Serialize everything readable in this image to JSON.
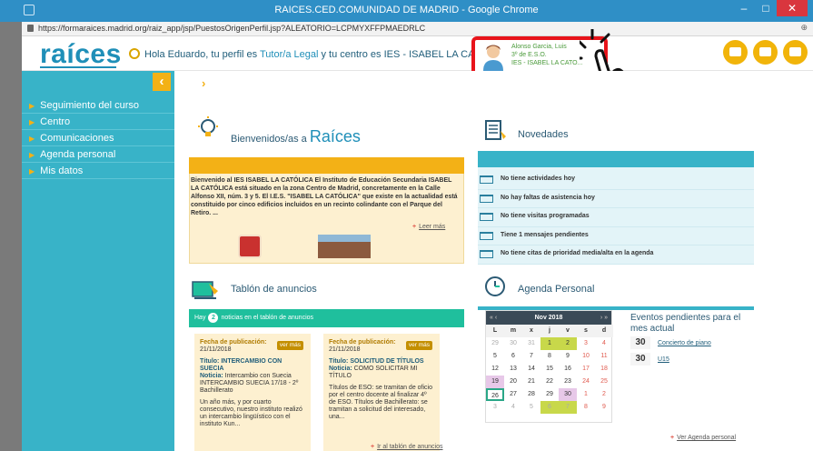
{
  "window": {
    "title": "RAICES.CED.COMUNIDAD DE MADRID - Google Chrome",
    "minimize": "–",
    "maximize": "□",
    "close": "✕"
  },
  "browser": {
    "url": "https://formaraices.madrid.org/raiz_app/jsp/PuestosOrigenPerfil.jsp?ALEATORIO=LCPMYXFFPMAEDRLC",
    "zoom_icon": "⊕"
  },
  "header": {
    "brand": "raíces",
    "greeting_prefix": "Hola Eduardo",
    "greeting_middle": ", tu perfil es ",
    "profile_link": "Tutor/a Legal",
    "greeting_suffix": " y tu centro es IES - ISABEL LA CATOLICA.",
    "close_icon": "✖",
    "profile_name": "Alonso Garcia, Luis",
    "profile_course": "3º de E.S.O.",
    "profile_school": "IES - ISABEL LA CATO...",
    "icons": [
      "mail-icon",
      "documents-icon",
      "settings-icon"
    ]
  },
  "sidebar": {
    "toggle": "‹",
    "items": [
      {
        "label": "Seguimiento del curso"
      },
      {
        "label": "Centro"
      },
      {
        "label": "Comunicaciones"
      },
      {
        "label": "Agenda personal"
      },
      {
        "label": "Mis datos"
      }
    ]
  },
  "main": {
    "breadcrumb_arrow": "›",
    "welcome": {
      "title_prefix": "Bienvenidos/as a",
      "title_brand": "Raíces",
      "text": "Bienvenido al IES ISABEL LA CATÓLICA El Instituto de Educación Secundaria ISABEL LA CATÓLICA está situado en la zona Centro de Madrid, concretamente en la Calle Alfonso XII, núm. 3 y 5. El I.E.S. \"ISABEL LA CATÓLICA\" que existe en la actualidad está constituido por cinco edificios incluidos en un recinto colindante con el Parque del Retiro. ...",
      "more_link": "Leer más"
    },
    "novedades": {
      "title": "Novedades",
      "items": [
        "No tiene actividades hoy",
        "No hay faltas de asistencia hoy",
        "No tiene visitas programadas",
        "Tiene 1 mensajes pendientes",
        "No tiene citas de prioridad media/alta en la agenda"
      ]
    },
    "tablon": {
      "title": "Tablón de anuncios",
      "bar_prefix": "Hay",
      "bar_count": "2",
      "bar_suffix": "noticias en el tablón de anuncios",
      "cards": [
        {
          "date_label": "Fecha de publicación:",
          "date": "21/11/2018",
          "button": "ver más",
          "title_label": "Título: INTERCAMBIO CON SUECIA",
          "notice_label": "Noticia:",
          "notice": "Intercambio con Suecia INTERCAMBIO SUECIA 17/18 - 2º Bachillerato",
          "body": "Un año más, y por cuarto consecutivo, nuestro instituto realizó un intercambio lingüístico con el instituto Kun..."
        },
        {
          "date_label": "Fecha de publicación:",
          "date": "21/11/2018",
          "button": "ver más",
          "title_label": "Título: SOLICITUD DE TÍTULOS",
          "notice_label": "Noticia:",
          "notice": "COMO SOLICITAR MI TÍTULO",
          "body": "Títulos de ESO: se tramitan de oficio por el centro docente al finalizar 4º de ESO. Títulos de Bachillerato: se tramitan a solicitud del interesado, una..."
        }
      ],
      "more_link": "Ir al tablón de anuncios"
    },
    "agenda": {
      "title": "Agenda Personal",
      "month": "Nov 2018",
      "nav_prev": "« ‹",
      "nav_next": "› »",
      "day_headers": [
        "L",
        "m",
        "x",
        "j",
        "v",
        "s",
        "d"
      ],
      "weeks": [
        [
          "29",
          "30",
          "31",
          "1",
          "2",
          "3",
          "4"
        ],
        [
          "5",
          "6",
          "7",
          "8",
          "9",
          "10",
          "11"
        ],
        [
          "12",
          "13",
          "14",
          "15",
          "16",
          "17",
          "18"
        ],
        [
          "19",
          "20",
          "21",
          "22",
          "23",
          "24",
          "25"
        ],
        [
          "26",
          "27",
          "28",
          "29",
          "30",
          "1",
          "2"
        ],
        [
          "3",
          "4",
          "5",
          "6",
          "7",
          "8",
          "9"
        ]
      ],
      "pending_title": "Eventos pendientes para el mes actual",
      "events": [
        {
          "day": "30",
          "label": "Concierto de piano"
        },
        {
          "day": "30",
          "label": "U15"
        }
      ],
      "more_link": "Ver Agenda personal"
    }
  }
}
